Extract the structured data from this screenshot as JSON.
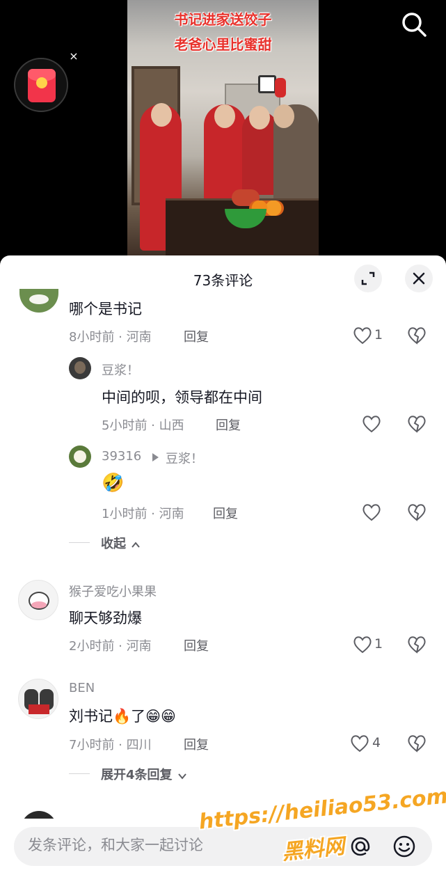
{
  "video": {
    "caption_line1": "书记进家送饺子",
    "caption_line2": "老爸心里比蜜甜",
    "search_icon": "search-icon",
    "redpack_close": "×"
  },
  "sheet": {
    "title": "73条评论",
    "expand_icon": "expand-icon",
    "close_icon": "close-icon"
  },
  "comments": [
    {
      "text": "哪个是书记",
      "meta": "8小时前 · 河南",
      "reply": "回复",
      "likes": "1",
      "replies": [
        {
          "name": "豆浆！",
          "text": "中间的呗，领导都在中间",
          "meta": "5小时前 · 山西",
          "reply": "回复"
        },
        {
          "name": "39316",
          "reply_to": "豆浆！",
          "text": "🤣",
          "meta": "1小时前 · 河南",
          "reply": "回复"
        }
      ],
      "fold_label": "收起"
    },
    {
      "name": "猴子爱吃小果果",
      "text": "聊天够劲爆",
      "meta": "2小时前 · 河南",
      "reply": "回复",
      "likes": "1"
    },
    {
      "name": "BEN",
      "text": "刘书记🔥了😁😁",
      "meta": "7小时前 · 四川",
      "reply": "回复",
      "likes": "4",
      "expand_label": "展开4条回复"
    }
  ],
  "input": {
    "placeholder": "发条评论，和大家一起讨论",
    "at_icon": "at-icon",
    "emoji_icon": "emoji-icon"
  },
  "watermark": {
    "line1": "https://heiliao53.com",
    "line2": "黑料网"
  },
  "colors": {
    "accent_red": "#e8322c",
    "watermark": "#f5a623",
    "text_primary": "#161823",
    "text_secondary": "#8a8b91"
  }
}
